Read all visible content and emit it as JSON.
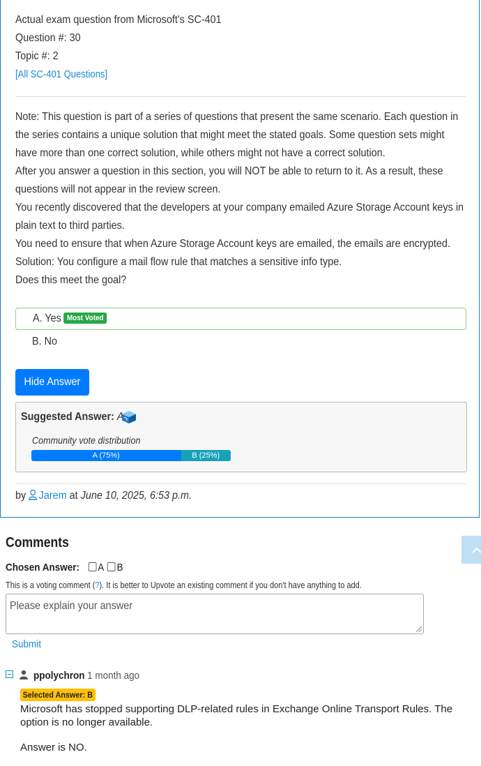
{
  "header": {
    "line1": "Actual exam question from Microsoft's SC-401",
    "line2": "Question #: 30",
    "line3": "Topic #: 2",
    "all_questions_link": "[All SC-401 Questions]"
  },
  "question": {
    "paragraphs": [
      "Note: This question is part of a series of questions that present the same scenario. Each question in the series contains a unique solution that might meet the stated goals. Some question sets might have more than one correct solution, while others might not have a correct solution.",
      "After you answer a question in this section, you will NOT be able to return to it. As a result, these questions will not appear in the review screen.",
      "You recently discovered that the developers at your company emailed Azure Storage Account keys in plain text to third parties.",
      "You need to ensure that when Azure Storage Account keys are emailed, the emails are encrypted.",
      "Solution: You configure a mail flow rule that matches a sensitive info type.",
      "Does this meet the goal?"
    ],
    "choices": [
      {
        "label": "A. Yes",
        "badge": "Most Voted"
      },
      {
        "label": "B. No",
        "badge": ""
      }
    ]
  },
  "answer": {
    "hide_button": "Hide Answer",
    "suggested_label": "Suggested Answer:",
    "suggested_value": "A",
    "community_label": "Community vote distribution",
    "votes": [
      {
        "label": "A (75%)",
        "percent": 75,
        "color": "#007bff"
      },
      {
        "label": "B (25%)",
        "percent": 25,
        "color": "#17a2b8"
      }
    ]
  },
  "byline": {
    "by": "by",
    "author": "Jarem",
    "at": "at",
    "date": "June 10, 2025, 6:53 p.m."
  },
  "comments": {
    "title": "Comments",
    "chosen_answer_label": "Chosen Answer:",
    "option_a": "A",
    "option_b": "B",
    "note_before": "This is a voting comment (",
    "note_link": "?",
    "note_after": "). It is better to Upvote an existing comment if you don't have anything to add.",
    "placeholder": "Please explain your answer",
    "submit": "Submit",
    "list": [
      {
        "user": "ppolychron",
        "time": "1 month ago",
        "selected": "Selected Answer: B",
        "body": [
          "Microsoft has stopped supporting DLP-related rules in Exchange Online Transport Rules. The option is no longer available.",
          "Answer is NO."
        ]
      }
    ]
  }
}
